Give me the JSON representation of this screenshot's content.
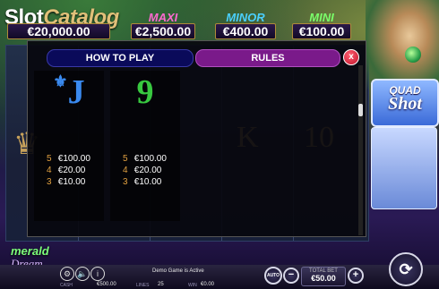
{
  "logo": {
    "part1": "Slot",
    "part2": "Catalog"
  },
  "jackpots": [
    {
      "name": "",
      "value": "€20,000.00",
      "color": "#ff7ad0"
    },
    {
      "name": "MAXI",
      "value": "€2,500.00",
      "color": "#ff6ad0"
    },
    {
      "name": "MINOR",
      "value": "€400.00",
      "color": "#4ad0ff"
    },
    {
      "name": "MINI",
      "value": "€100.00",
      "color": "#7aff6a"
    }
  ],
  "tabs": {
    "how_to_play": "HOW TO PLAY",
    "rules": "RULES",
    "close": "x"
  },
  "paytable": [
    {
      "symbol": "J",
      "symbol_color": "#3a8af0",
      "suit": "⚜",
      "payouts": [
        {
          "count": "5",
          "amount": "€100.00"
        },
        {
          "count": "4",
          "amount": "€20.00"
        },
        {
          "count": "3",
          "amount": "€10.00"
        }
      ]
    },
    {
      "symbol": "9",
      "symbol_color": "#38c840",
      "payouts": [
        {
          "count": "5",
          "amount": "€100.00"
        },
        {
          "count": "4",
          "amount": "€20.00"
        },
        {
          "count": "3",
          "amount": "€10.00"
        }
      ]
    }
  ],
  "reel_symbols": {
    "k": "K",
    "ten": "10"
  },
  "side_panel": {
    "line1": "QUAD",
    "line2": "Shot"
  },
  "game_logo": {
    "line1": "merald",
    "line2": "Dream"
  },
  "bottom": {
    "cash_label": "CASH",
    "cash_value": "€500.00",
    "lines_label": "LINES",
    "lines_value": "25",
    "win_label": "WIN",
    "win_value": "€0.00",
    "status": "Demo Game is Active",
    "total_bet_label": "TOTAL BET",
    "total_bet_value": "€50.00",
    "minus": "−",
    "plus": "+",
    "auto": "AUTO",
    "info": "i"
  }
}
